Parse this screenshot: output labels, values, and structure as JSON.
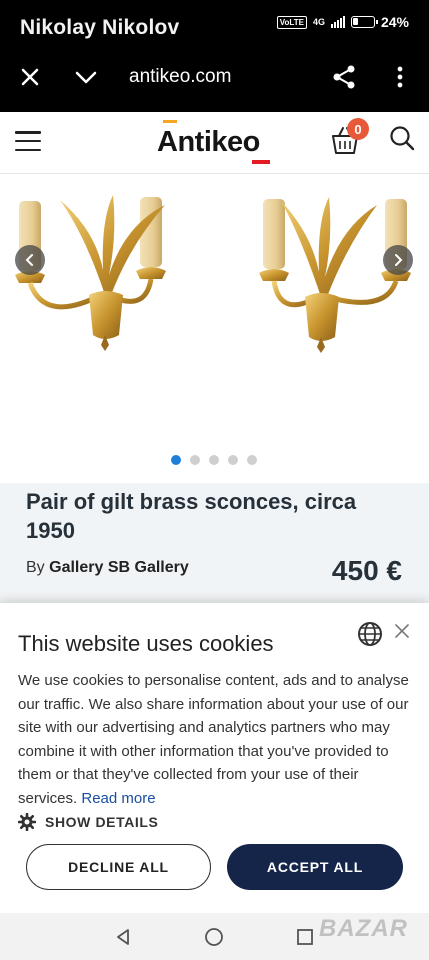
{
  "status_bar": {
    "owner_name": "Nikolay Nikolov",
    "network_badge": "VoLTE",
    "network_type": "4G",
    "battery": "24%",
    "battery_level": 0.24
  },
  "browser": {
    "url": "antikeo.com"
  },
  "site": {
    "logo": "Antikeo",
    "cart_count": "0"
  },
  "gallery": {
    "image_description_icon": "brass-sconces-image",
    "dot_count": 5,
    "active_dot": 0
  },
  "product": {
    "title": "Pair of gilt brass sconces, circa 1950",
    "by_prefix": "By",
    "seller": "Gallery SB Gallery",
    "price": "450 €"
  },
  "cookies": {
    "title": "This website uses cookies",
    "body": "We use cookies to personalise content, ads and to analyse our traffic. We also share information about your use of our site with our advertising and analytics partners who may combine it with other information that you've provided to them or that they've collected from your use of their services.",
    "read_more": "Read more",
    "show_details": "SHOW DETAILS",
    "decline_label": "DECLINE ALL",
    "accept_label": "ACCEPT ALL",
    "accent_color": "#15254a"
  },
  "watermark": "BAZAR"
}
